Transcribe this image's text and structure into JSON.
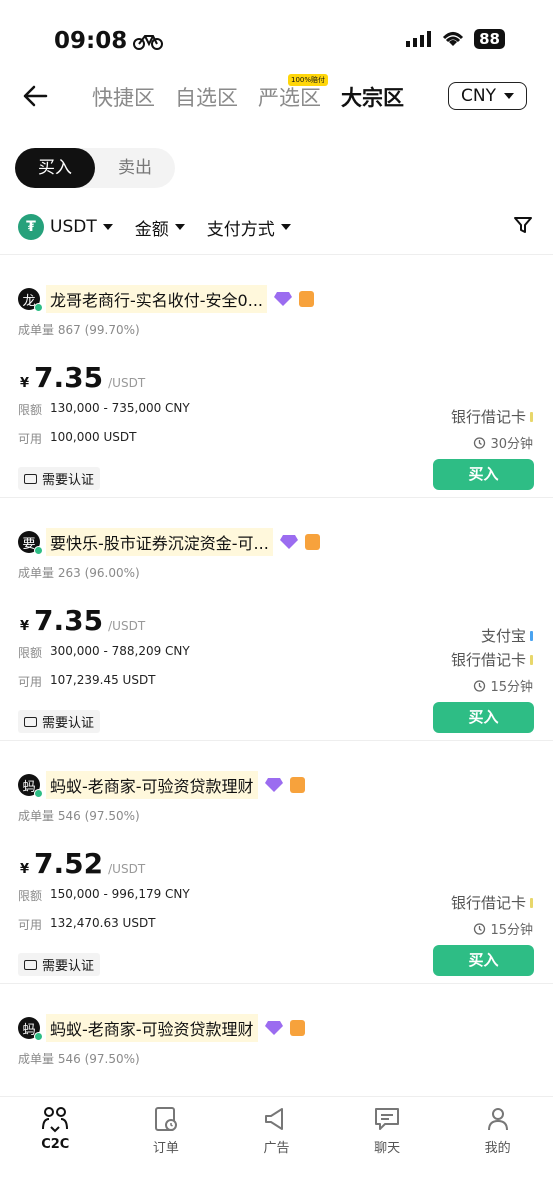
{
  "status_bar": {
    "time": "09:08",
    "battery": "88"
  },
  "nav": {
    "tabs": [
      {
        "label": "快捷区"
      },
      {
        "label": "自选区"
      },
      {
        "label": "严选区",
        "badge": "100%赔付"
      },
      {
        "label": "大宗区"
      }
    ],
    "currency": "CNY"
  },
  "segment": {
    "buy": "买入",
    "sell": "卖出"
  },
  "filters": {
    "asset": "USDT",
    "amount": "金额",
    "payment": "支付方式"
  },
  "labels": {
    "orders": "成单量",
    "limit": "限额",
    "available": "可用",
    "unit": "/USDT",
    "currency_symbol": "¥",
    "kyc": "需要认证",
    "buy_button": "买入"
  },
  "cards": [
    {
      "avatar": "龙",
      "name": "龙哥老商行-实名收付-安全0...",
      "orders": "867 (99.70%)",
      "price": "7.35",
      "limit": "130,000 - 735,000 CNY",
      "available": "100,000 USDT",
      "payments": [
        "银行借记卡"
      ],
      "time": "30分钟"
    },
    {
      "avatar": "要",
      "name": "要快乐-股市证券沉淀资金-可...",
      "orders": "263 (96.00%)",
      "price": "7.35",
      "limit": "300,000 - 788,209 CNY",
      "available": "107,239.45 USDT",
      "payments": [
        "支付宝",
        "银行借记卡"
      ],
      "time": "15分钟"
    },
    {
      "avatar": "蚂",
      "name": "蚂蚁-老商家-可验资贷款理财",
      "orders": "546 (97.50%)",
      "price": "7.52",
      "limit": "150,000 - 996,179 CNY",
      "available": "132,470.63 USDT",
      "payments": [
        "银行借记卡"
      ],
      "time": "15分钟"
    },
    {
      "avatar": "蚂",
      "name": "蚂蚁-老商家-可验资贷款理财",
      "orders": "546 (97.50%)"
    }
  ],
  "bottom_nav": [
    {
      "label": "C2C",
      "icon": "c2c-icon"
    },
    {
      "label": "订单",
      "icon": "orders-icon"
    },
    {
      "label": "广告",
      "icon": "megaphone-icon"
    },
    {
      "label": "聊天",
      "icon": "chat-icon"
    },
    {
      "label": "我的",
      "icon": "profile-icon"
    }
  ],
  "colors": {
    "accent": "#2ebd85",
    "tether": "#26a17b",
    "highlight": "#fff8dc"
  }
}
